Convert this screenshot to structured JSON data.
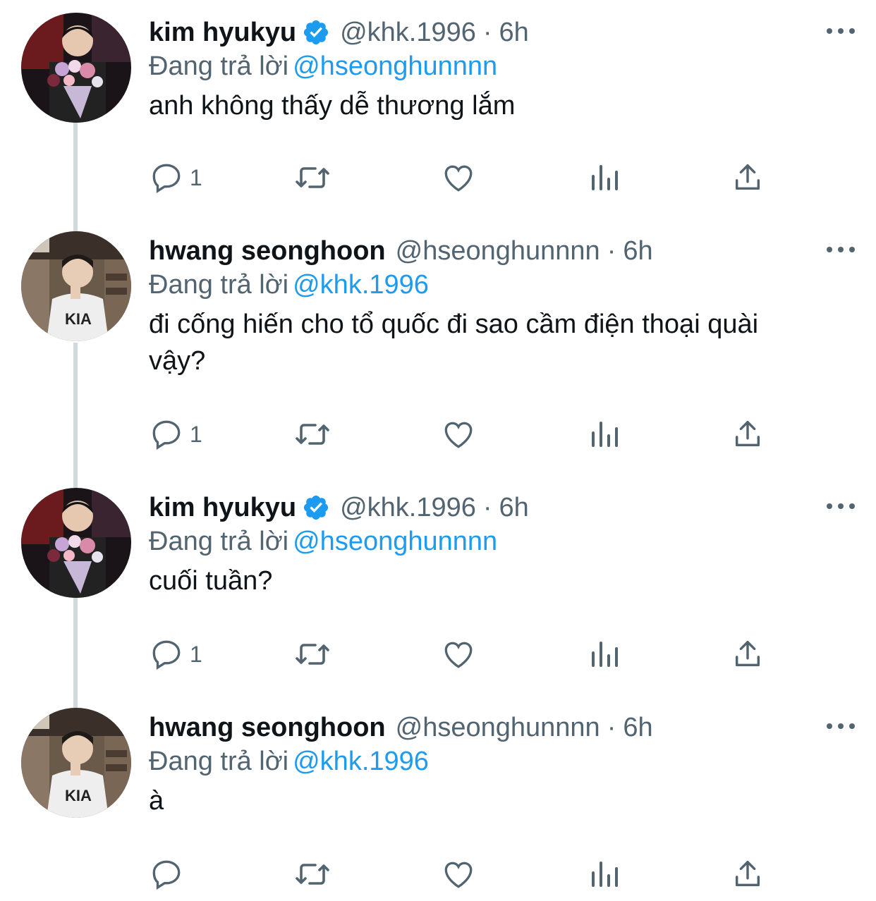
{
  "colors": {
    "accent": "#1d9bf0",
    "muted": "#536471",
    "text": "#0f1419",
    "thread_line": "#cfd9de"
  },
  "tweets": [
    {
      "name": "kim hyukyu",
      "verified": true,
      "handle": "@khk.1996",
      "separator": "·",
      "time": "6h",
      "reply_label": "Đang trả lời",
      "reply_to": "@hseonghunnnn",
      "text": "anh không thấy dễ thương lắm",
      "reply_count": "1",
      "avatar": "avatar-kim"
    },
    {
      "name": "hwang seonghoon",
      "verified": false,
      "handle": "@hseonghunnnn",
      "separator": "·",
      "time": "6h",
      "reply_label": "Đang trả lời",
      "reply_to": "@khk.1996",
      "text": "đi cống hiến cho tổ quốc đi sao cầm điện thoại quài vậy?",
      "reply_count": "1",
      "avatar": "avatar-hwang"
    },
    {
      "name": "kim hyukyu",
      "verified": true,
      "handle": "@khk.1996",
      "separator": "·",
      "time": "6h",
      "reply_label": "Đang trả lời",
      "reply_to": "@hseonghunnnn",
      "text": "cuối tuần?",
      "reply_count": "1",
      "avatar": "avatar-kim"
    },
    {
      "name": "hwang seonghoon",
      "verified": false,
      "handle": "@hseonghunnnn",
      "separator": "·",
      "time": "6h",
      "reply_label": "Đang trả lời",
      "reply_to": "@khk.1996",
      "text": "à",
      "reply_count": "",
      "avatar": "avatar-hwang"
    }
  ],
  "icons": {
    "reply": "reply-icon",
    "retweet": "retweet-icon",
    "like": "heart-icon",
    "views": "analytics-icon",
    "share": "share-icon",
    "more": "more-icon",
    "verified": "verified-badge-icon"
  }
}
